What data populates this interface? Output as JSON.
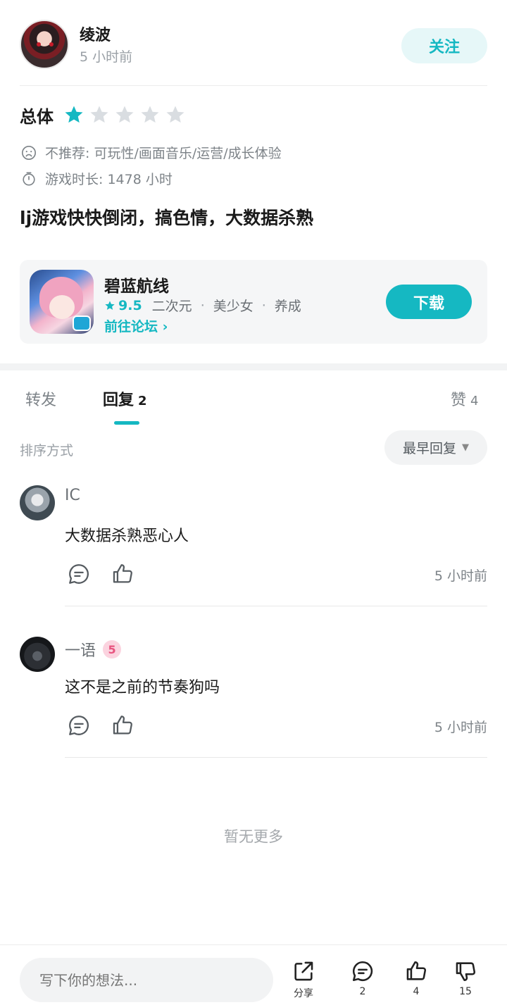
{
  "author": {
    "name": "绫波",
    "time": "5 小时前",
    "follow_label": "关注"
  },
  "rating": {
    "label": "总体",
    "stars": 1,
    "max_stars": 5,
    "not_recommend": "不推荐: 可玩性/画面音乐/运营/成长体验",
    "play_time": "游戏时长: 1478 小时"
  },
  "review_text": "lj游戏快快倒闭，搞色情，大数据杀熟",
  "game": {
    "name": "碧蓝航线",
    "score": "9.5",
    "tags": [
      "二次元",
      "美少女",
      "养成"
    ],
    "tag_separator": "·",
    "forum_link": "前往论坛 ›",
    "download_label": "下载"
  },
  "tabs": [
    {
      "label": "转发",
      "count": ""
    },
    {
      "label": "回复",
      "count": "2"
    },
    {
      "label": "赞",
      "count": "4"
    }
  ],
  "sort": {
    "label": "排序方式",
    "value": "最早回复"
  },
  "replies": [
    {
      "name": "IC",
      "text": "大数据杀熟恶心人",
      "time": "5 小时前",
      "badge": ""
    },
    {
      "name": "一语",
      "text": "这不是之前的节奏狗吗",
      "time": "5 小时前",
      "badge": "5"
    }
  ],
  "no_more": "暂无更多",
  "bottom_bar": {
    "input_placeholder": "写下你的想法...",
    "share_label": "分享",
    "comment_count": "2",
    "like_count": "4",
    "dislike_count": "15"
  },
  "colors": {
    "accent": "#15b8c2",
    "star_active": "#15b8c2",
    "star_inactive": "#d9dde1"
  }
}
